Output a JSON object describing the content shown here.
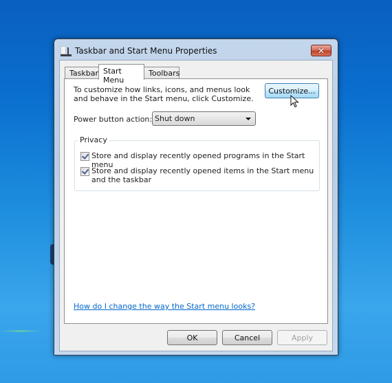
{
  "window": {
    "title": "Taskbar and Start Menu Properties",
    "close_label": "✕"
  },
  "tabs": [
    {
      "label": "Taskbar",
      "active": false
    },
    {
      "label": "Start Menu",
      "active": true
    },
    {
      "label": "Toolbars",
      "active": false
    }
  ],
  "start_menu": {
    "intro_text": "To customize how links, icons, and menus look and behave in the Start menu, click Customize.",
    "customize_label": "Customize...",
    "power_label": "Power button action:",
    "power_value": "Shut down",
    "privacy": {
      "title": "Privacy",
      "options": [
        {
          "label": "Store and display recently opened programs in the Start menu",
          "checked": true
        },
        {
          "label": "Store and display recently opened items in the Start menu and the taskbar",
          "checked": true
        }
      ]
    },
    "help_link": "How do I change the way the Start menu looks?"
  },
  "buttons": {
    "ok": "OK",
    "cancel": "Cancel",
    "apply": "Apply"
  }
}
